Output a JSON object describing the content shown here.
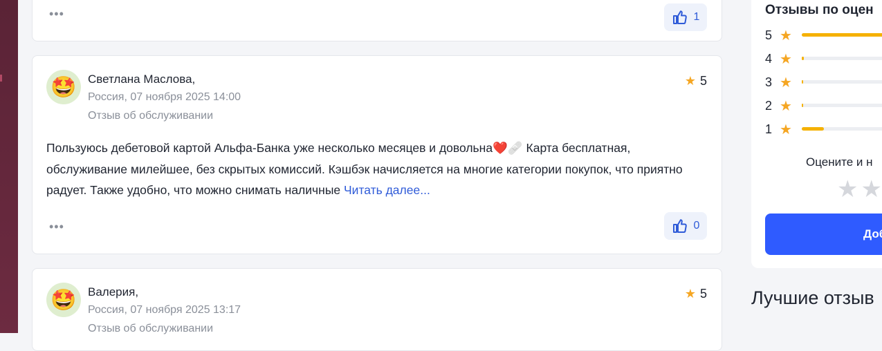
{
  "colors": {
    "accent": "#2f5bd8",
    "star": "#f5a623",
    "button": "#2f5bff"
  },
  "reviews": [
    {
      "like_count": "1"
    },
    {
      "author": "Светлана Маслова,",
      "location_date": "Россия, 07 ноября 2025 14:00",
      "category": "Отзыв об обслуживании",
      "rating": "5",
      "avatar_emoji": "🤩",
      "text": "Пользуюсь дебетовой картой Альфа-Банка уже несколько месяцев и довольна",
      "emoji_after": "❤️🩹",
      "text_cont": " Карта бесплатная, обслуживание милейшее, без скрытых комиссий. Кэшбэк начисляется на многие категории покупок, что приятно радует. Также удобно, что можно снимать наличные ",
      "read_more": "Читать далее...",
      "like_count": "0"
    },
    {
      "author": "Валерия,",
      "location_date": "Россия, 07 ноября 2025 13:17",
      "category": "Отзыв об обслуживании",
      "rating": "5",
      "avatar_emoji": "🤩"
    }
  ],
  "sidebar": {
    "title": "Отзывы по оцен",
    "rows": [
      {
        "label": "5",
        "fraction": 0.95
      },
      {
        "label": "4",
        "fraction": 0.02
      },
      {
        "label": "3",
        "fraction": 0.01
      },
      {
        "label": "2",
        "fraction": 0.01
      },
      {
        "label": "1",
        "fraction": 0.2
      }
    ],
    "rate_prompt": "Оцените и н",
    "rate_stars": "★★",
    "add_button": "Доб",
    "best_title": "Лучшие отзыв"
  }
}
